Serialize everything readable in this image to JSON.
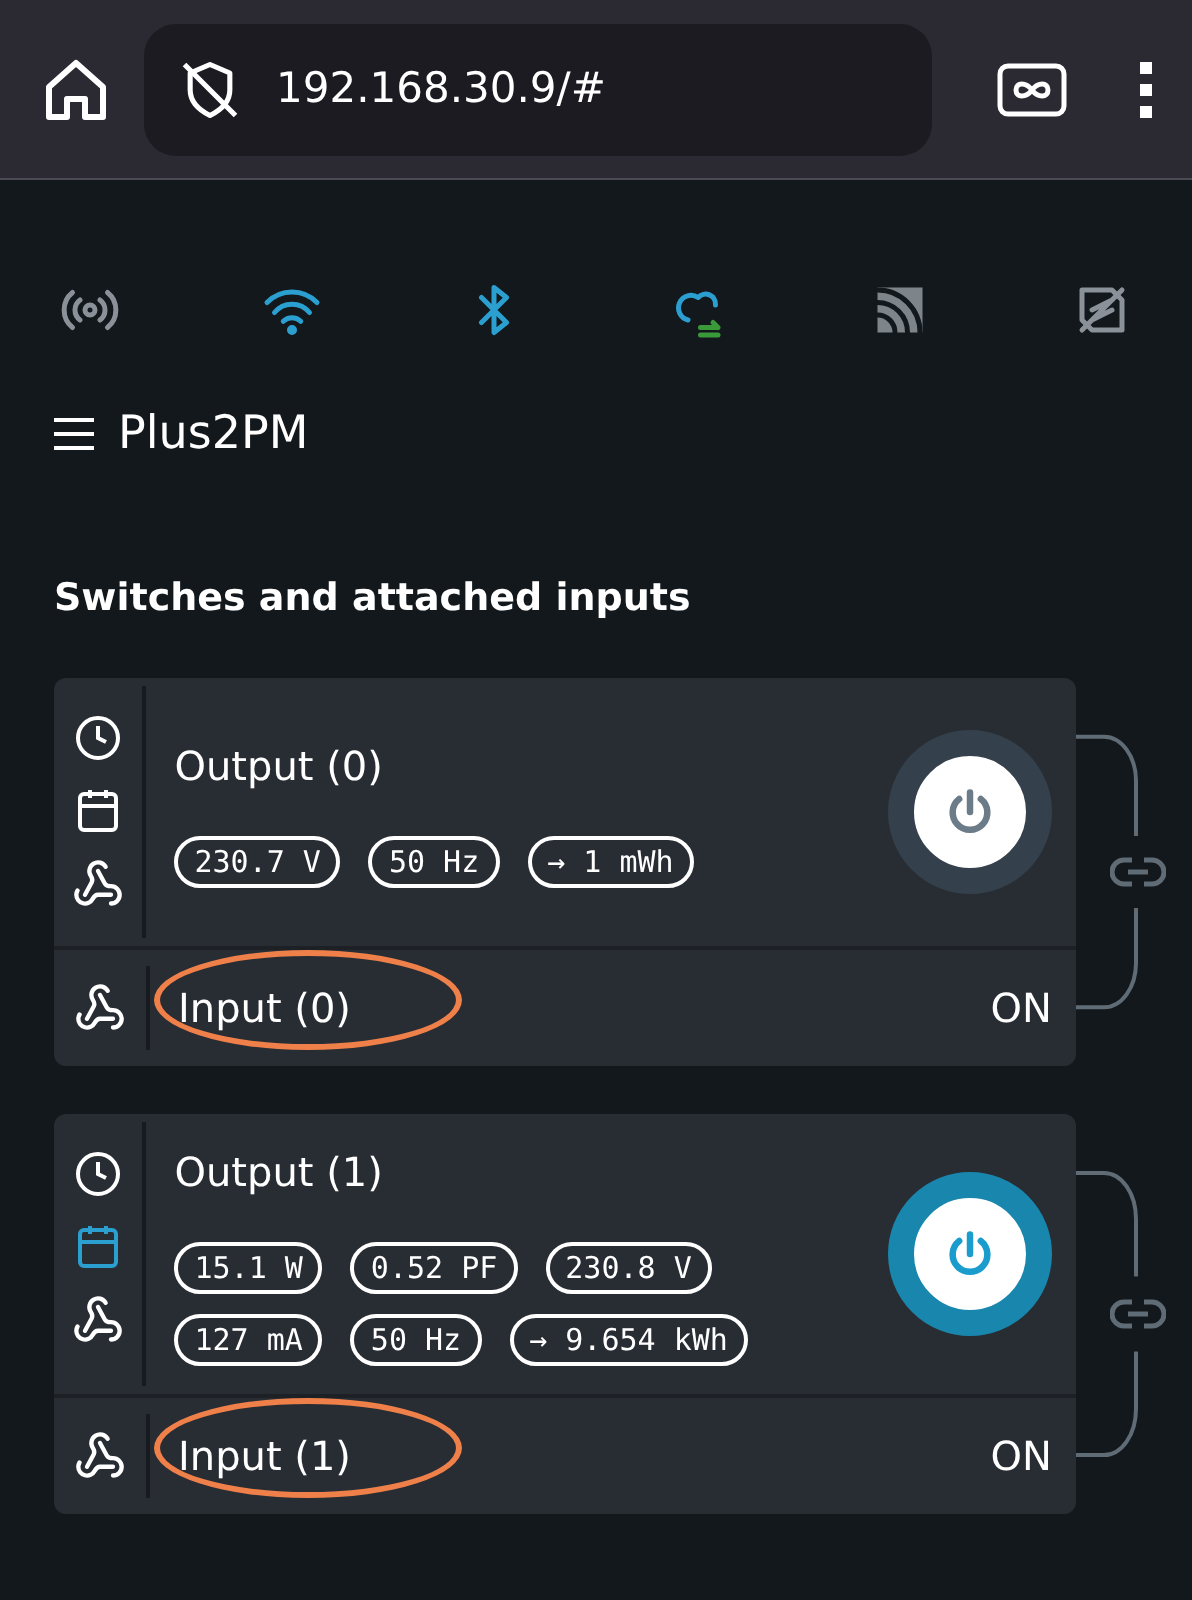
{
  "browser": {
    "url": "192.168.30.9/#"
  },
  "status_icons": [
    {
      "kind": "ap",
      "active": false
    },
    {
      "kind": "wifi",
      "active": true
    },
    {
      "kind": "bluetooth",
      "active": true
    },
    {
      "kind": "cloud",
      "active": true
    },
    {
      "kind": "mqtt",
      "active": false
    },
    {
      "kind": "websocket",
      "active": false
    }
  ],
  "device": {
    "title": "Plus2PM"
  },
  "section_title": "Switches and attached inputs",
  "switches": [
    {
      "output": "Output (0)",
      "on": false,
      "schedule_active": false,
      "readings": [
        "230.7 V",
        "50 Hz",
        "→ 1 mWh"
      ],
      "input": "Input (0)",
      "input_state": "ON",
      "input_circled": true
    },
    {
      "output": "Output (1)",
      "on": true,
      "schedule_active": true,
      "readings": [
        "15.1 W",
        "0.52 PF",
        "230.8 V",
        "127 mA",
        "50 Hz",
        "→ 9.654 kWh"
      ],
      "input": "Input (1)",
      "input_state": "ON",
      "input_circled": true
    }
  ]
}
